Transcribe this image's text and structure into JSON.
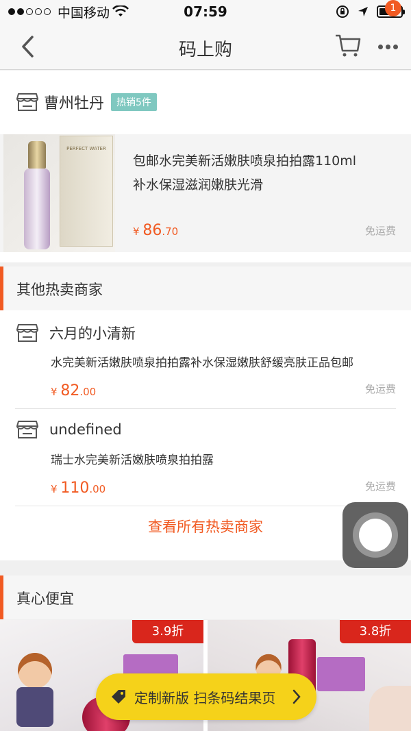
{
  "status_bar": {
    "carrier": "中国移动",
    "time": "07:59"
  },
  "nav": {
    "title": "码上购",
    "badge_count": "1"
  },
  "shop": {
    "name": "曹州牡丹",
    "hot_tag": "热销5件"
  },
  "product": {
    "title_line1": "包邮水完美新活嫩肤喷泉拍拍露110ml",
    "title_line2": "补水保湿滋润嫩肤光滑",
    "currency": "¥",
    "price_int": "86",
    "price_dec": ".70",
    "shipping": "免运费",
    "box_brand": "PERFECT WATER"
  },
  "other_sellers": {
    "heading": "其他热卖商家",
    "items": [
      {
        "name": "六月的小清新",
        "desc": "水完美新活嫩肤喷泉拍拍露补水保湿嫩肤舒缓亮肤正品包邮",
        "currency": "¥",
        "price_int": "82",
        "price_dec": ".00",
        "shipping": "免运费"
      },
      {
        "name": "undefined",
        "desc": "瑞士水完美新活嫩肤喷泉拍拍露",
        "currency": "¥",
        "price_int": "110",
        "price_dec": ".00",
        "shipping": "免运费"
      }
    ],
    "see_all": "查看所有热卖商家"
  },
  "deals": {
    "heading": "真心便宜",
    "items": [
      {
        "discount": "3.9折"
      },
      {
        "discount": "3.8折"
      }
    ]
  },
  "promo_pill": {
    "label": "定制新版 扫条码结果页"
  },
  "colors": {
    "accent": "#f15a22",
    "tag_teal": "#7fc8c0",
    "discount_red": "#d9261c",
    "pill_yellow": "#f5d21a"
  }
}
